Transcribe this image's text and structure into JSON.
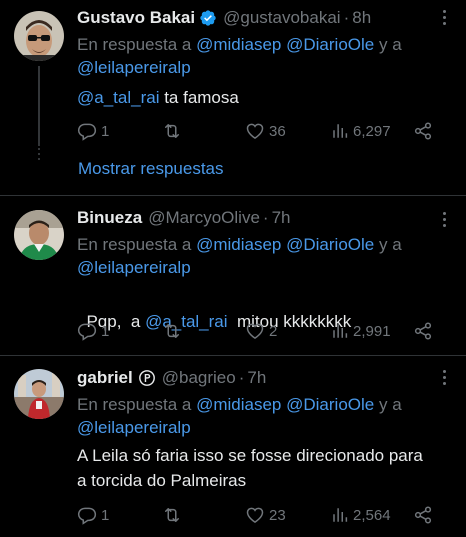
{
  "colors": {
    "background": "#000000",
    "text": "#e7e9ea",
    "muted": "#71767b",
    "link": "#4a99e9",
    "verified": "#1d9bf0",
    "divider": "#2f3336"
  },
  "reply_prefix": "En respuesta a",
  "reply_and": "y a",
  "tweets": [
    {
      "name": "Gustavo Bakai",
      "handle": "@gustavobakai",
      "sep": "·",
      "time": "8h",
      "badge": "verified-icon",
      "reply_mentions": [
        "@midiasep",
        "@DiarioOle",
        "@leilapereiralp"
      ],
      "body_mention": "@a_tal_rai",
      "body_text": " ta famosa",
      "replies": "1",
      "retweets": "",
      "likes": "36",
      "views": "6,297"
    },
    {
      "name": "Binueza",
      "handle": "@MarcyoOlive",
      "sep": "·",
      "time": "7h",
      "badge": "",
      "reply_mentions": [
        "@midiasep",
        "@DiarioOle",
        "@leilapereiralp"
      ],
      "body_prefix": "Pqp,  a ",
      "body_mention": "@a_tal_rai",
      "body_text": "  mitou kkkkkkkk",
      "replies": "1",
      "retweets": "",
      "likes": "2",
      "views": "2,991"
    },
    {
      "name": "gabriel",
      "handle": "@bagrieo",
      "sep": "·",
      "time": "7h",
      "badge": "p-badge-icon",
      "reply_mentions": [
        "@midiasep",
        "@DiarioOle",
        "@leilapereiralp"
      ],
      "body_line1": "A Leila só faria isso se fosse direcionado para",
      "body_line2": "a torcida do Palmeiras",
      "replies": "1",
      "retweets": "",
      "likes": "23",
      "views": "2,564"
    }
  ],
  "show_replies": "Mostrar respuestas"
}
